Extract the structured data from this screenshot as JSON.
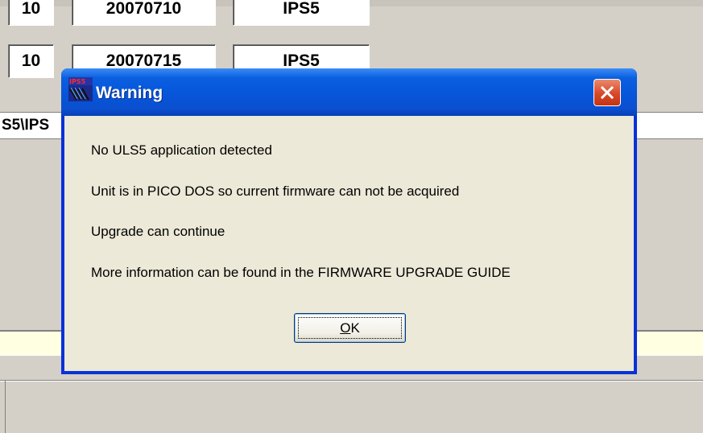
{
  "background": {
    "rows": [
      {
        "num": "10",
        "date": "20070710",
        "type": "IPS5"
      },
      {
        "num": "10",
        "date": "20070715",
        "type": "IPS5"
      }
    ],
    "path_text": "S5\\IPS"
  },
  "dialog": {
    "title": "Warning",
    "messages": [
      "No ULS5 application detected",
      "Unit is in PICO DOS so current firmware can not be acquired",
      "Upgrade can continue",
      "More information can be found in the FIRMWARE UPGRADE GUIDE"
    ],
    "ok_label": "OK",
    "ok_mnemonic": "O"
  },
  "icons": {
    "app_icon": "ips5-app-icon",
    "close": "close-icon"
  },
  "colors": {
    "titlebar": "#0754d8",
    "client": "#ece9d8",
    "close_button": "#d8472a",
    "window_bg": "#d4d0c8"
  }
}
